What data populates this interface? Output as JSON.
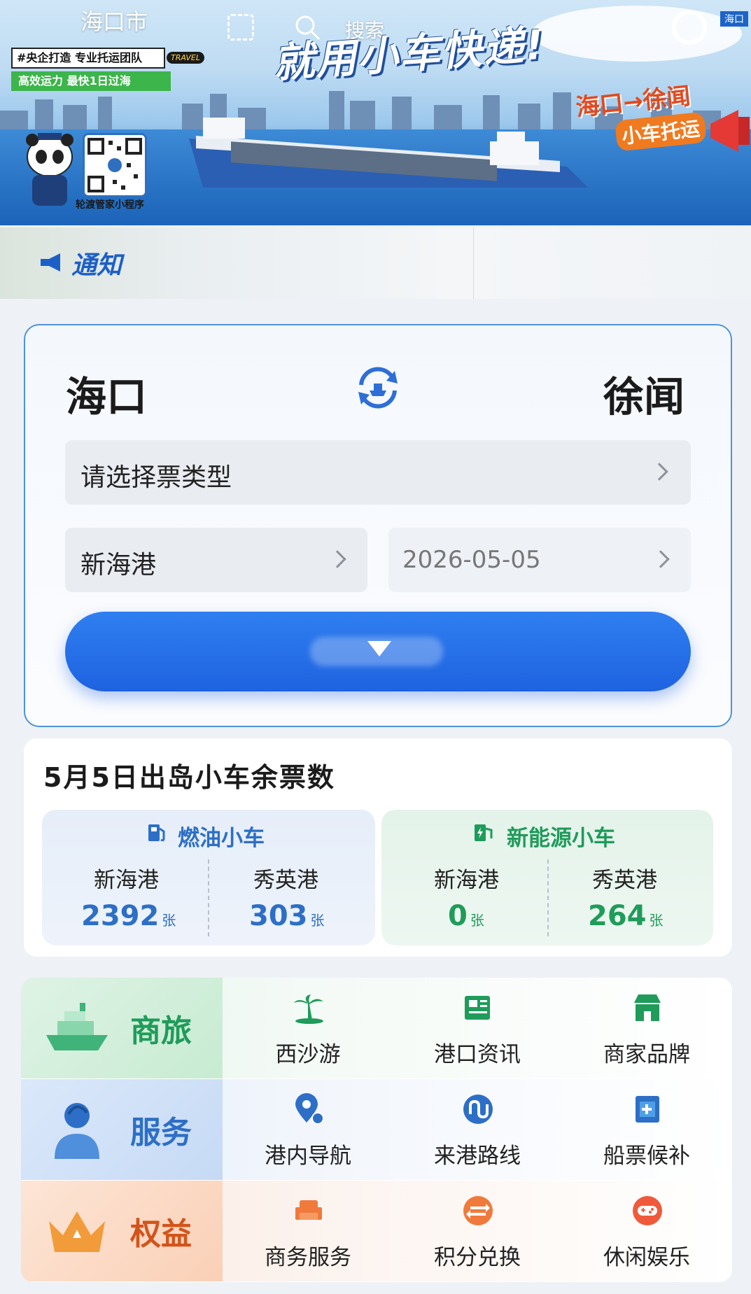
{
  "banner": {
    "city": "海口市",
    "search_label": "搜索",
    "headline": "就用小车快递!",
    "tag_line1": "#央企打造 专业托运团队",
    "tag_line2": "高效运力 最快1日过海",
    "travel_badge": "TRAVEL",
    "route_promo": "海口→徐闻",
    "route_promo2": "小车托运",
    "qr_caption": "轮渡管家小程序",
    "corner_tag": "海口"
  },
  "notice": {
    "label": "通知"
  },
  "booking": {
    "from_city": "海口",
    "to_city": "徐闻",
    "ticket_type_placeholder": "请选择票类型",
    "port": "新海港",
    "date": "2026-05-05"
  },
  "availability": {
    "title": "5月5日出岛小车余票数",
    "unit": "张",
    "fuel": {
      "title": "燃油小车",
      "ports": [
        {
          "name": "新海港",
          "count": "2392"
        },
        {
          "name": "秀英港",
          "count": "303"
        }
      ]
    },
    "ev": {
      "title": "新能源小车",
      "ports": [
        {
          "name": "新海港",
          "count": "0"
        },
        {
          "name": "秀英港",
          "count": "264"
        }
      ]
    }
  },
  "services": {
    "rows": [
      {
        "label": "商旅",
        "items": [
          "西沙游",
          "港口资讯",
          "商家品牌"
        ]
      },
      {
        "label": "服务",
        "items": [
          "港内导航",
          "来港路线",
          "船票候补"
        ]
      },
      {
        "label": "权益",
        "items": [
          "商务服务",
          "积分兑换",
          "休闲娱乐"
        ]
      }
    ]
  },
  "colors": {
    "primary_blue": "#1e62e0",
    "fuel_blue": "#2d6fc6",
    "ev_green": "#1f9b5a",
    "notice_blue": "#1c5fc7"
  }
}
